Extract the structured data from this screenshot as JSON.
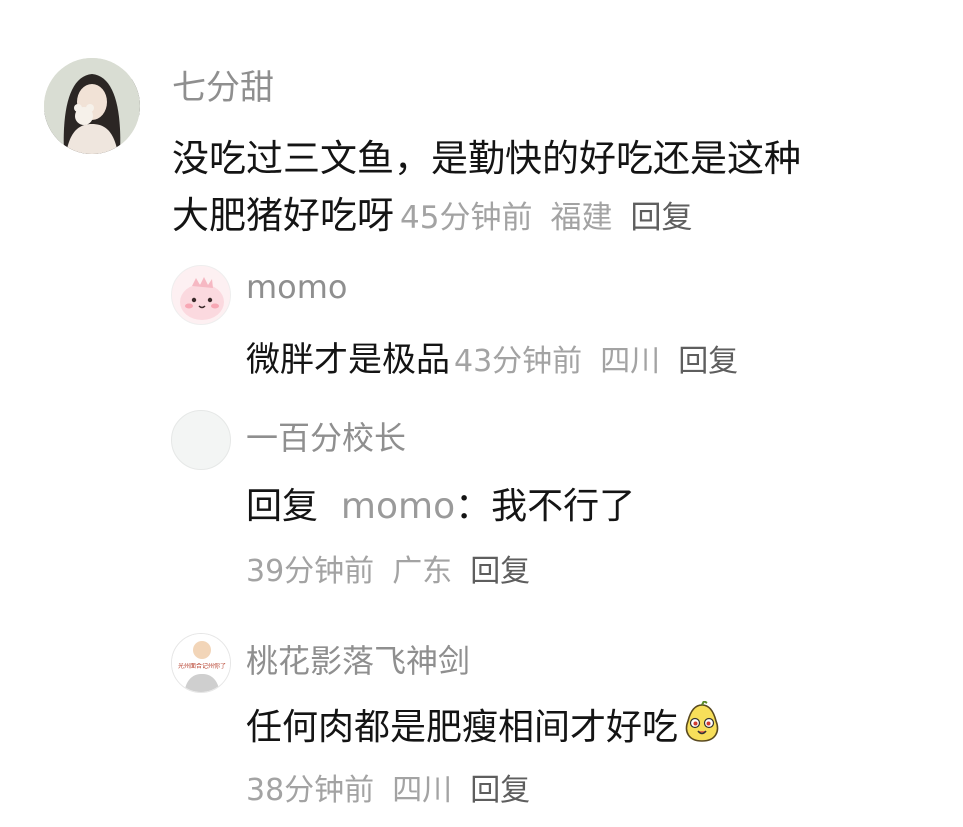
{
  "comments": [
    {
      "author": "七分甜",
      "text_line1": "没吃过三文鱼，是勤快的好吃还是这种",
      "text_line2": "大肥猪好吃呀",
      "time": "45分钟前",
      "location": "福建",
      "reply_label": "回复"
    }
  ],
  "replies": [
    {
      "author": "momo",
      "text": "微胖才是极品",
      "time": "43分钟前",
      "location": "四川",
      "reply_label": "回复"
    },
    {
      "author": "一百分校长",
      "prefix": "回复",
      "mention": "momo",
      "separator": "：",
      "text": "我不行了",
      "time": "39分钟前",
      "location": "广东",
      "reply_label": "回复"
    },
    {
      "author": "桃花影落飞神剑",
      "avatar_caption": "光州面合记州你了",
      "text": "任何肉都是肥瘦相间才好吃",
      "emoji": "smiling-pear-emoji",
      "time": "38分钟前",
      "location": "四川",
      "reply_label": "回复"
    }
  ],
  "colors": {
    "name": "#8f8f8f",
    "text": "#141414",
    "meta": "#a3a3a3",
    "reply": "#5e5e5e"
  }
}
